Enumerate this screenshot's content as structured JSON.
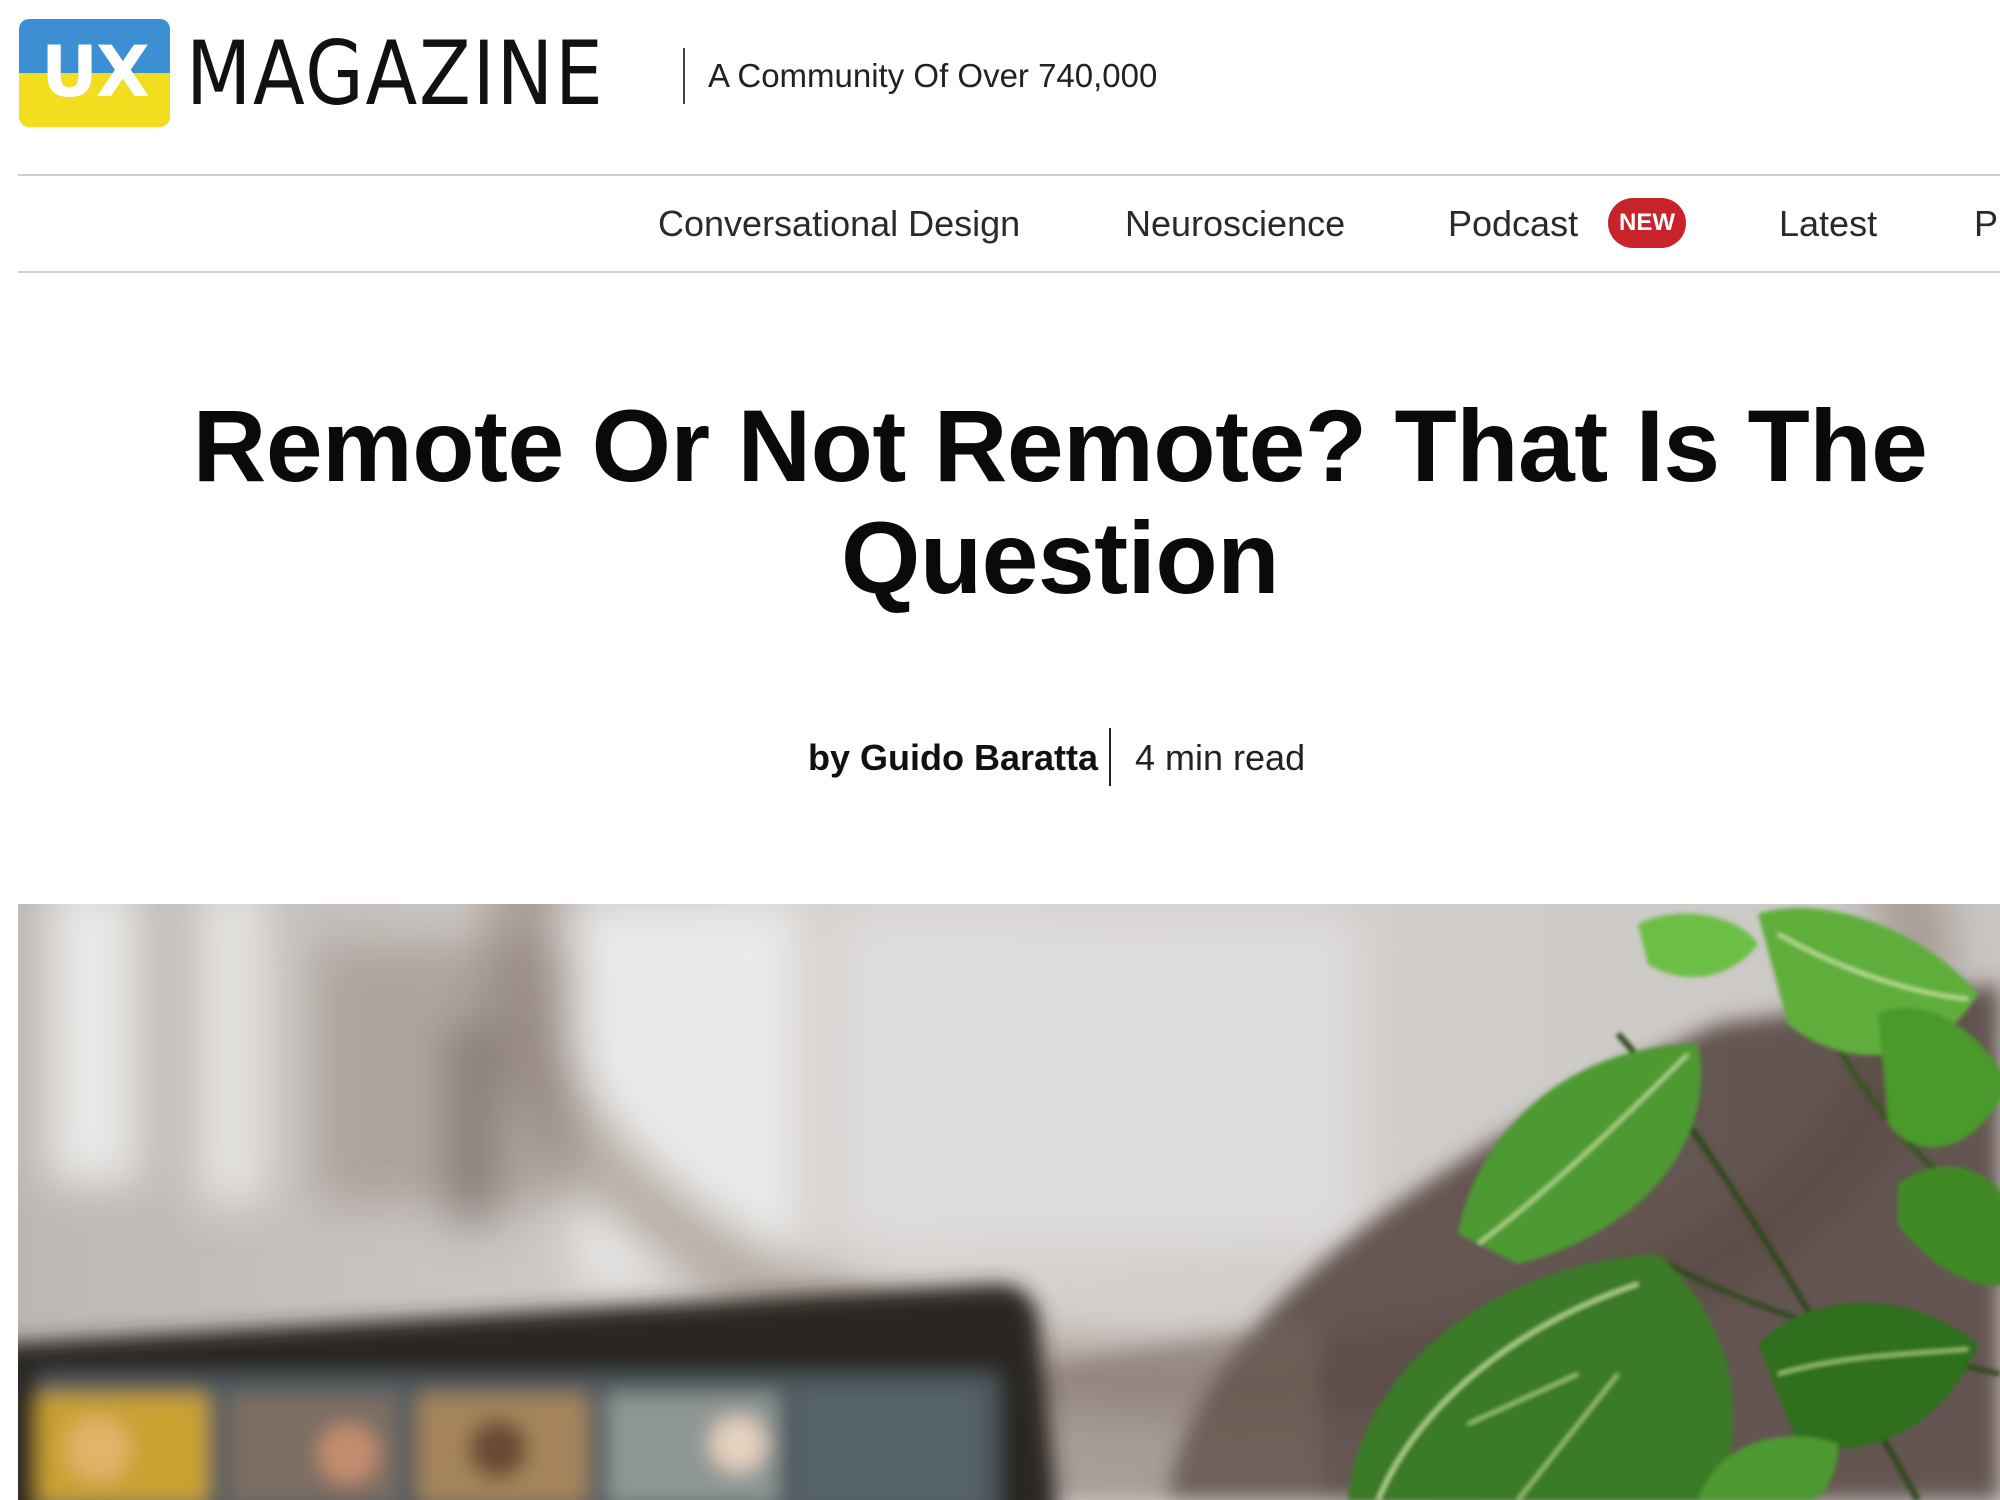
{
  "header": {
    "logo_mark": "UX",
    "logo_word": "MAGAZINE",
    "tagline": "A Community Of Over 740,000"
  },
  "nav": {
    "items": [
      {
        "label": "Conversational Design"
      },
      {
        "label": "Neuroscience"
      },
      {
        "label": "Podcast",
        "badge": "NEW"
      },
      {
        "label": "Latest"
      },
      {
        "label": "P"
      }
    ]
  },
  "article": {
    "title": "Remote Or Not Remote? That Is The Question",
    "byline_author": "by Guido Baratta",
    "read_time": "4 min read",
    "hero_image": "blurred-laptop-video-call-with-green-plant"
  },
  "colors": {
    "logo_blue": "#3d8fd4",
    "logo_yellow": "#f2dd1e",
    "badge_red": "#c8222b",
    "divider_gray": "#cfcfcf"
  }
}
